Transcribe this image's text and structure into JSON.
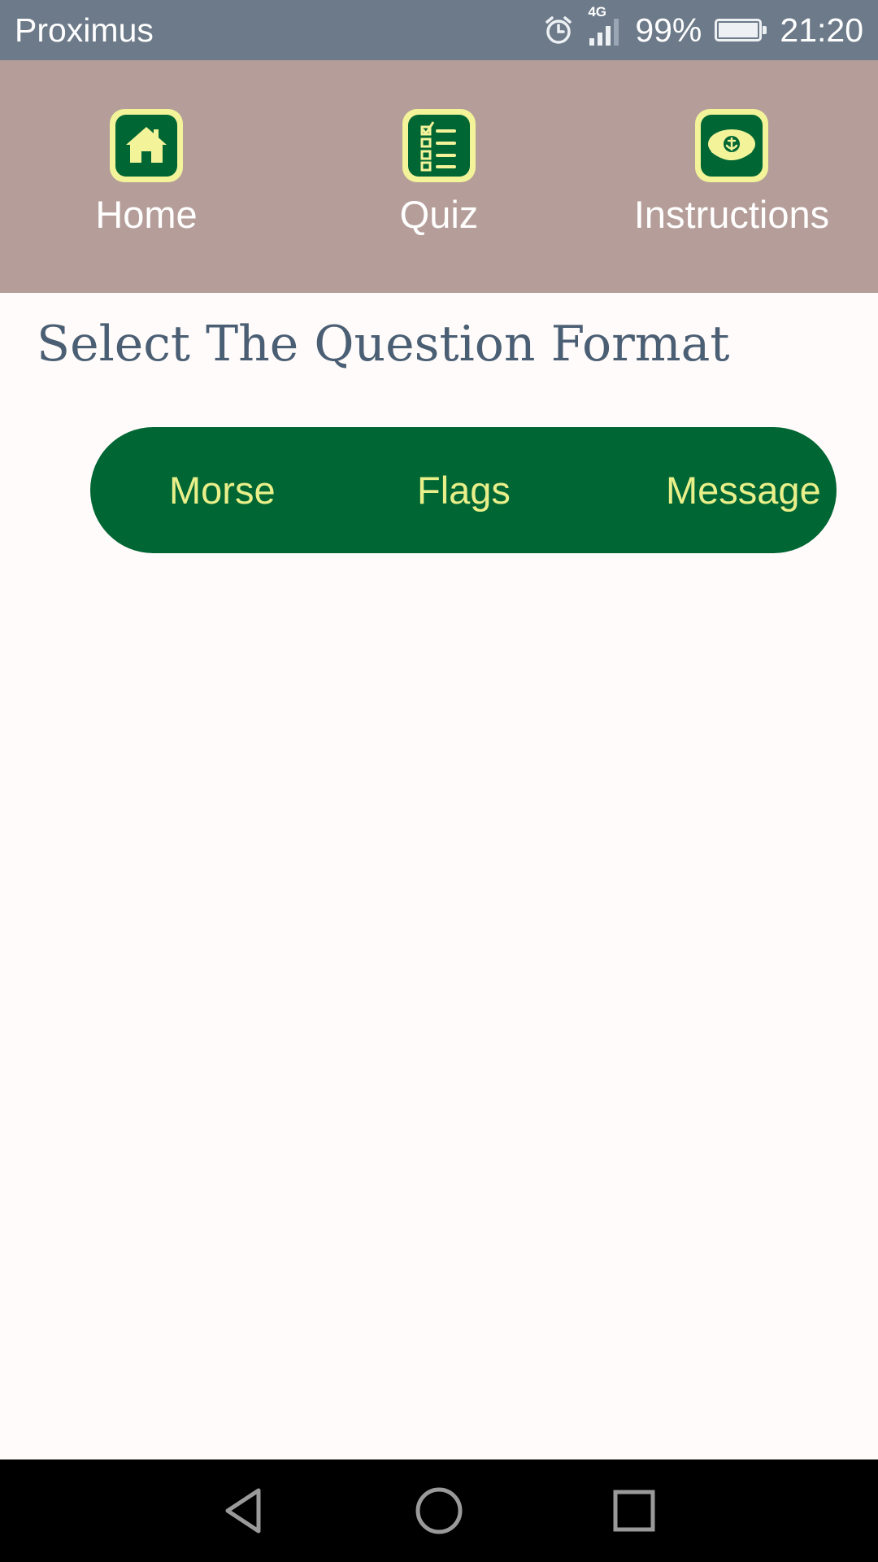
{
  "status_bar": {
    "carrier": "Proximus",
    "network": "4G",
    "battery": "99%",
    "battery_level": 0.99,
    "time": "21:20",
    "icons": [
      "alarm-icon",
      "signal-icon",
      "battery-icon"
    ]
  },
  "top_nav": {
    "items": [
      {
        "label": "Home",
        "icon": "home-icon"
      },
      {
        "label": "Quiz",
        "icon": "checklist-icon"
      },
      {
        "label": "Instructions",
        "icon": "captain-hat-icon"
      }
    ]
  },
  "main": {
    "title": "Select The Question Format",
    "formats": [
      {
        "label": "Morse"
      },
      {
        "label": "Flags"
      },
      {
        "label": "Message"
      }
    ]
  },
  "system_nav": {
    "buttons": [
      "back-icon",
      "home-circle-icon",
      "recents-icon"
    ]
  },
  "colors": {
    "status_bar": "#6c7a89",
    "top_nav": "#b59e99",
    "accent_green": "#006633",
    "accent_yellow": "#f3f39a",
    "title_text": "#4b5f74",
    "background": "#fffbfa"
  }
}
